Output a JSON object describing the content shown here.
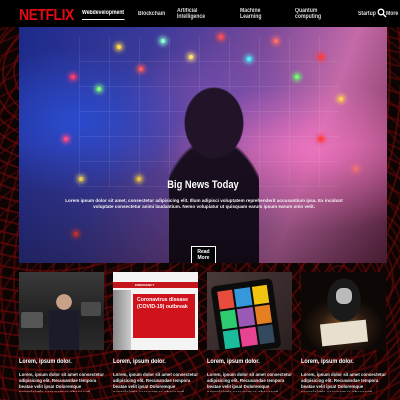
{
  "brand": {
    "logo": "NETFLIX",
    "color": "#e50914"
  },
  "nav": {
    "items": [
      {
        "label": "Webdevelopment",
        "active": true
      },
      {
        "label": "Blockchain",
        "active": false
      },
      {
        "label": "Artificial Intelligence",
        "active": false
      },
      {
        "label": "Machine Learning",
        "active": false
      },
      {
        "label": "Quantum computing",
        "active": false
      },
      {
        "label": "Startup",
        "active": false
      },
      {
        "label": "More",
        "active": false
      }
    ],
    "search_icon": "search-icon"
  },
  "hero": {
    "title": "Big News Today",
    "text": "Lorem ipsum dolor sit amet, consectetur adipisicing elit. Illum adipisci voluptatem reprehenderit accusantium ipsa. Ex incidunt voluptate consectetur animi laudantium. Nemo volupiatur ut quisquam earum ipsum earum onin velit.",
    "button_label": "Read More"
  },
  "cards": [
    {
      "title": "Lorem, ipsum dolor.",
      "text": "Lorem, ipsum dolor sit amet consectetur adipisicing elit. Recusandae tempora beatae velit ipsa! Doloremque perspiciatis accusamus obcaecati officia."
    },
    {
      "title": "Lorem, ipsum dolor.",
      "text": "Lorem, ipsum dolor sit amet consectetur adipisicing elit. Recusandae tempora beatae velit ipsa! Doloremque perspiciatis accusamus obcaecati officia.",
      "image_text": "Coronavirus disease (COVID-19) outbreak",
      "image_header": "EMERGENCY"
    },
    {
      "title": "Lorem, ipsum dolor.",
      "text": "Lorem, ipsum dolor sit amet consectetur adipisicing elit. Recusandae tempora beatae velit ipsa! Doloremque perspiciatis accusamus obcaecati officia."
    },
    {
      "title": "Lorem, ipsum dolor.",
      "text": "Lorem, ipsum dolor sit amet consectetur adipisicing elit. Recusandae tempora beatae velit ipsa! Doloremque perspiciatis accusamus obcaecati officia."
    }
  ]
}
